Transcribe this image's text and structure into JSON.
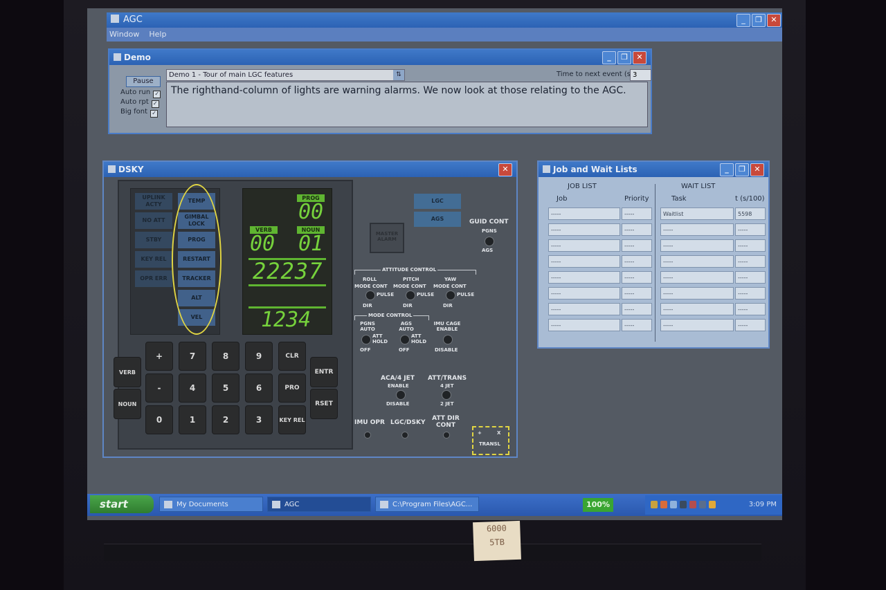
{
  "app": {
    "title": "AGC",
    "menu": [
      "Window",
      "Help"
    ]
  },
  "demo": {
    "title": "Demo",
    "pause_label": "Pause",
    "options": [
      {
        "label": "Auto run",
        "checked": true
      },
      {
        "label": "Auto rpt",
        "checked": true
      },
      {
        "label": "Big font",
        "checked": true
      }
    ],
    "selected_demo": "Demo 1 - Tour of main LGC features",
    "time_label": "Time to next event (s)",
    "time_value": "3",
    "narration": "The righthand-column of lights are warning alarms. We now look at those relating to the AGC."
  },
  "dsky": {
    "title": "DSKY",
    "left_lamps": [
      "UPLINK ACTY",
      "NO ATT",
      "STBY",
      "KEY REL",
      "OPR ERR"
    ],
    "right_lamps": [
      "TEMP",
      "GIMBAL LOCK",
      "PROG",
      "RESTART",
      "TRACKER",
      "ALT",
      "VEL"
    ],
    "prog_label": "PROG",
    "verb_label": "VERB",
    "noun_label": "NOUN",
    "prog_value": "00",
    "verb_value": "00",
    "noun_value": "01",
    "register1": "22237",
    "register3": "1234",
    "keys": {
      "plus": "+",
      "minus": "-",
      "k0": "0",
      "k1": "1",
      "k2": "2",
      "k3": "3",
      "k4": "4",
      "k5": "5",
      "k6": "6",
      "k7": "7",
      "k8": "8",
      "k9": "9",
      "verb": "VERB",
      "noun": "NOUN",
      "clr": "CLR",
      "pro": "PRO",
      "key_rel": "KEY REL",
      "entr": "ENTR",
      "rset": "RSET"
    },
    "right_panel": {
      "lgc": "LGC",
      "ags": "AGS",
      "master_alarm": "MASTER ALARM",
      "guid_cont": "GUID CONT",
      "pgns": "PGNS",
      "ags_sw": "AGS",
      "attitude_control": "ATTITUDE CONTROL",
      "roll": "ROLL",
      "pitch": "PITCH",
      "yaw": "YAW",
      "mode_cont": "MODE CONT",
      "pulse": "PULSE",
      "dir": "DIR",
      "mode_control": "MODE CONTROL",
      "pgns_auto": "PGNS AUTO",
      "ags_auto": "AGS AUTO",
      "att_hold": "ATT HOLD",
      "off": "OFF",
      "imu_cage_enable": "IMU CAGE ENABLE",
      "disable": "DISABLE",
      "aca_jet": "ACA/4 JET",
      "enable": "ENABLE",
      "att_trans": "ATT/TRANS",
      "four_jet": "4 JET",
      "two_jet": "2 JET",
      "imu_opr": "IMU OPR",
      "lgc_dsky": "LGC/DSKY",
      "att_dir_cont": "ATT DIR CONT",
      "transl": "TRANSL",
      "transl_plus": "+",
      "transl_x": "X"
    }
  },
  "jobs": {
    "title": "Job and Wait Lists",
    "job_list_header": "JOB LIST",
    "wait_list_header": "WAIT LIST",
    "col_job": "Job",
    "col_priority": "Priority",
    "col_task": "Task",
    "col_t": "t (s/100)",
    "job_rows": [
      {
        "job": "-----",
        "priority": "-----"
      },
      {
        "job": "-----",
        "priority": "-----"
      },
      {
        "job": "-----",
        "priority": "-----"
      },
      {
        "job": "-----",
        "priority": "-----"
      },
      {
        "job": "-----",
        "priority": "-----"
      },
      {
        "job": "-----",
        "priority": "-----"
      },
      {
        "job": "-----",
        "priority": "-----"
      },
      {
        "job": "-----",
        "priority": "-----"
      }
    ],
    "wait_rows": [
      {
        "task": "Waitlist",
        "t": "5598"
      },
      {
        "task": "-----",
        "t": "-----"
      },
      {
        "task": "-----",
        "t": "-----"
      },
      {
        "task": "-----",
        "t": "-----"
      },
      {
        "task": "-----",
        "t": "-----"
      },
      {
        "task": "-----",
        "t": "-----"
      },
      {
        "task": "-----",
        "t": "-----"
      },
      {
        "task": "-----",
        "t": "-----"
      }
    ]
  },
  "taskbar": {
    "start": "start",
    "tasks": [
      "My Documents",
      "AGC",
      "C:\\Program Files\\AGC..."
    ],
    "battery": "100%",
    "clock": "3:09 PM"
  },
  "sticker": [
    "6000",
    "5TB"
  ],
  "colors": {
    "titlebar": "#3f79c8",
    "dsky_digits": "#76d23c",
    "highlight": "#e1d543",
    "lamp": "#41618a"
  }
}
